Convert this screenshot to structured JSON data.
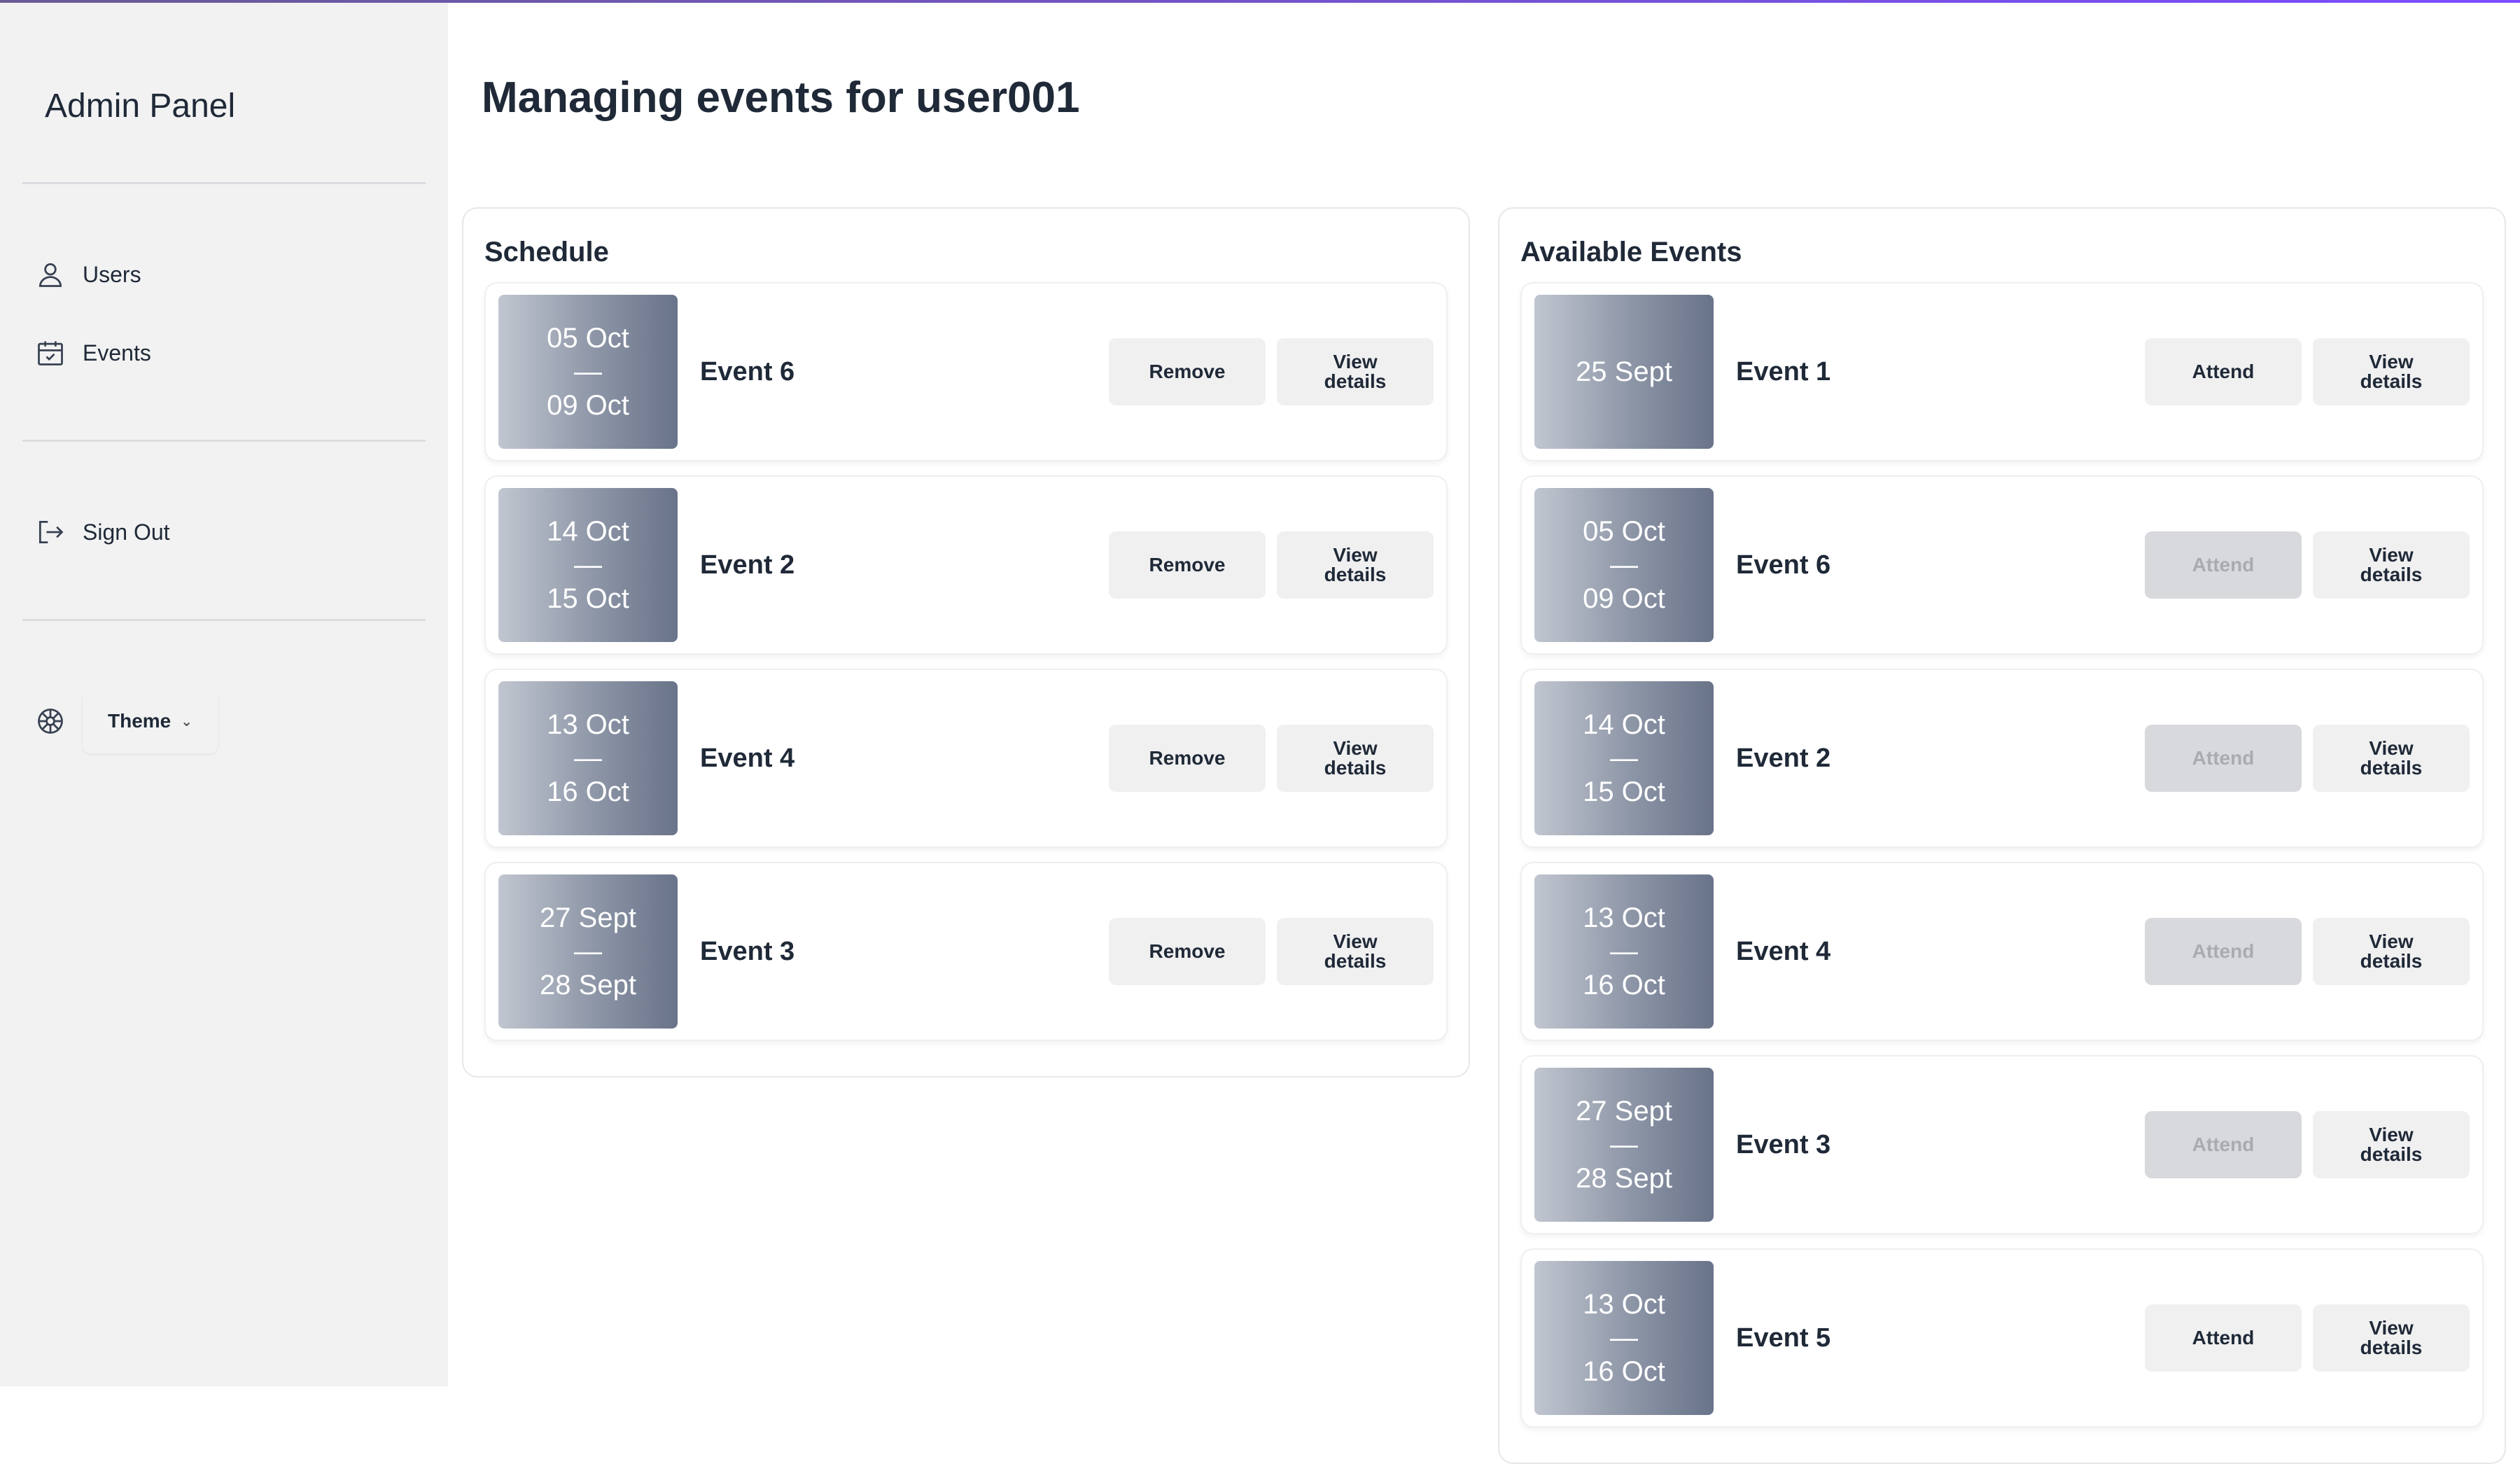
{
  "sidebar": {
    "title": "Admin Panel",
    "nav": [
      {
        "label": "Users",
        "icon": "users-icon"
      },
      {
        "label": "Events",
        "icon": "calendar-icon"
      }
    ],
    "sign_out": {
      "label": "Sign Out",
      "icon": "sign-out-icon"
    },
    "theme": {
      "label": "Theme",
      "icon": "palette-icon"
    }
  },
  "main": {
    "title": "Managing events for user001"
  },
  "schedule": {
    "title": "Schedule",
    "items": [
      {
        "start": "05 Oct",
        "sep": "—",
        "end": "09 Oct",
        "name": "Event 6",
        "action": "Remove",
        "details": "View details"
      },
      {
        "start": "14 Oct",
        "sep": "—",
        "end": "15 Oct",
        "name": "Event 2",
        "action": "Remove",
        "details": "View details"
      },
      {
        "start": "13 Oct",
        "sep": "—",
        "end": "16 Oct",
        "name": "Event 4",
        "action": "Remove",
        "details": "View details"
      },
      {
        "start": "27 Sept",
        "sep": "—",
        "end": "28 Sept",
        "name": "Event 3",
        "action": "Remove",
        "details": "View details"
      }
    ]
  },
  "available": {
    "title": "Available Events",
    "items": [
      {
        "start": "25 Sept",
        "sep": "",
        "end": "",
        "name": "Event 1",
        "action": "Attend",
        "disabled": false,
        "details": "View details"
      },
      {
        "start": "05 Oct",
        "sep": "—",
        "end": "09 Oct",
        "name": "Event 6",
        "action": "Attend",
        "disabled": true,
        "details": "View details"
      },
      {
        "start": "14 Oct",
        "sep": "—",
        "end": "15 Oct",
        "name": "Event 2",
        "action": "Attend",
        "disabled": true,
        "details": "View details"
      },
      {
        "start": "13 Oct",
        "sep": "—",
        "end": "16 Oct",
        "name": "Event 4",
        "action": "Attend",
        "disabled": true,
        "details": "View details"
      },
      {
        "start": "27 Sept",
        "sep": "—",
        "end": "28 Sept",
        "name": "Event 3",
        "action": "Attend",
        "disabled": true,
        "details": "View details"
      },
      {
        "start": "13 Oct",
        "sep": "—",
        "end": "16 Oct",
        "name": "Event 5",
        "action": "Attend",
        "disabled": false,
        "details": "View details"
      }
    ]
  }
}
